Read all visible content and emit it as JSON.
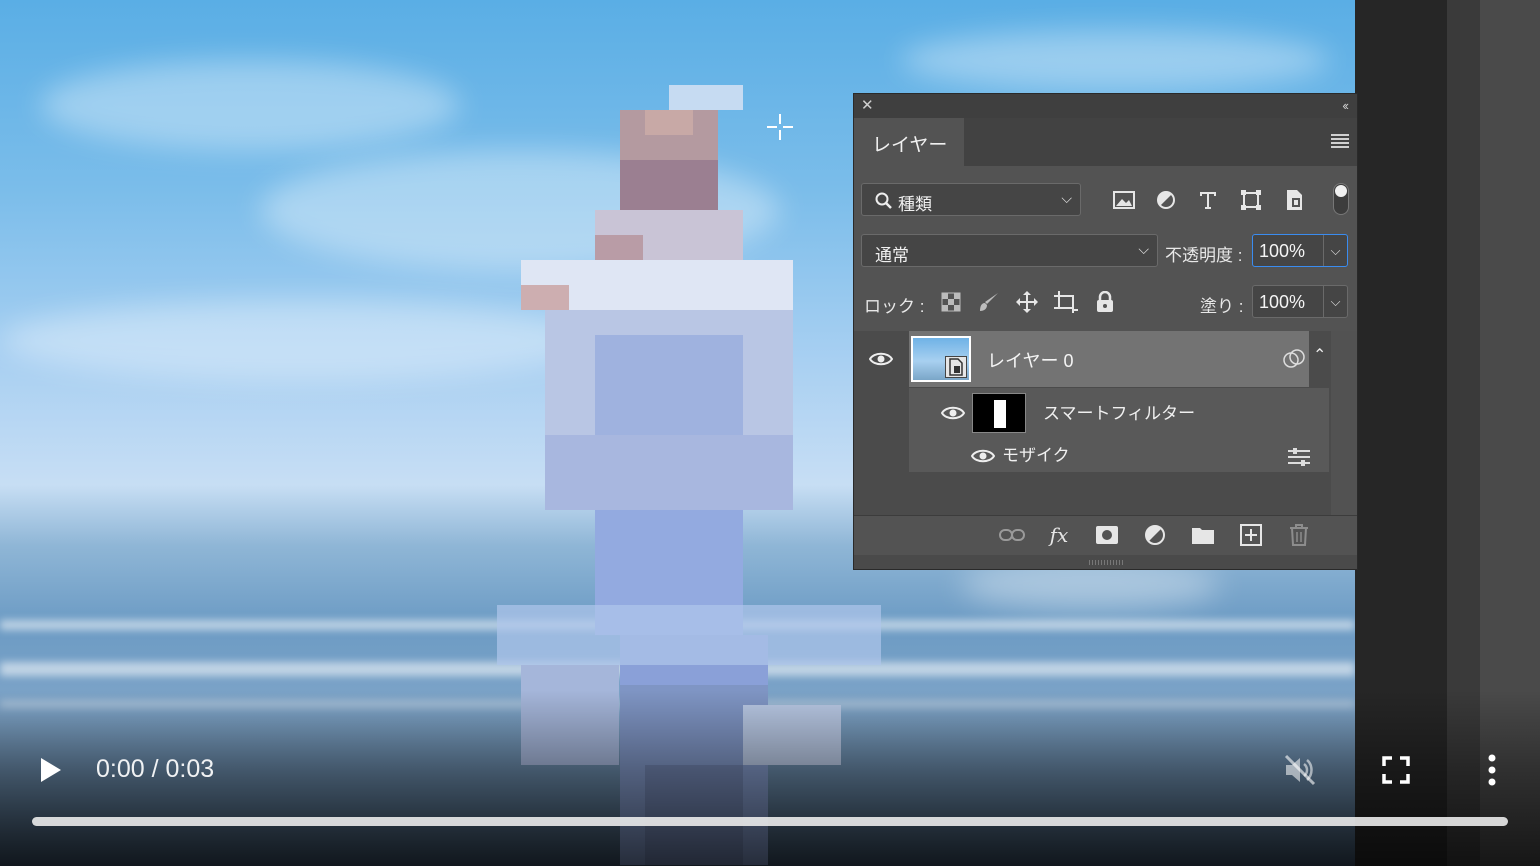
{
  "video": {
    "current_time": "0:00",
    "separator": "/",
    "duration": "0:03",
    "progress_fraction": 0,
    "muted": true
  },
  "layers_panel": {
    "tab_label": "レイヤー",
    "filter": {
      "kind_label": "種類"
    },
    "blend_mode": "通常",
    "opacity_label": "不透明度 :",
    "opacity_value": "100%",
    "lock_label": "ロック :",
    "fill_label": "塗り :",
    "fill_value": "100%",
    "layers": [
      {
        "name": "レイヤー 0",
        "visible": true,
        "smart_filters_label": "スマートフィルター",
        "filters": [
          {
            "name": "モザイク",
            "visible": true
          }
        ]
      }
    ]
  },
  "icons": {
    "close": "close-icon",
    "collapse": "double-chevron-left-icon",
    "panel_menu": "hamburger-menu-icon",
    "search": "search-icon",
    "filter_image": "image-filter-icon",
    "filter_adjustment": "adjustment-filter-icon",
    "filter_type": "type-filter-icon",
    "filter_shape": "shape-filter-icon",
    "filter_smart_object": "smart-object-filter-icon",
    "lock_transparent": "lock-transparent-pixels-icon",
    "lock_image": "lock-image-pixels-icon",
    "lock_position": "lock-position-icon",
    "lock_artboard": "lock-artboard-icon",
    "lock_all": "lock-all-icon",
    "link": "link-layers-icon",
    "fx": "fx-icon",
    "mask": "add-mask-icon",
    "adjustment": "new-adjustment-layer-icon",
    "group": "new-group-folder-icon",
    "new_layer": "new-layer-icon",
    "trash": "delete-layer-icon",
    "play": "play-icon",
    "mute": "muted-speaker-icon",
    "fullscreen": "fullscreen-icon",
    "more": "more-vertical-icon"
  },
  "colors": {
    "panel_bg": "#535353",
    "selected_layer": "#737373",
    "focus_blue": "#3a8cf0"
  }
}
